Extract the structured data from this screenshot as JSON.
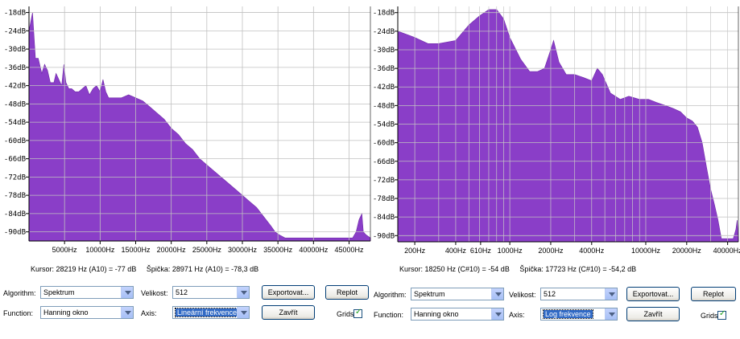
{
  "left": {
    "chart_data": {
      "type": "area",
      "x_scale": "linear",
      "y_unit": "dB",
      "y_ticks": [
        "-18dB",
        "-24dB",
        "-30dB",
        "-36dB",
        "-42dB",
        "-48dB",
        "-54dB",
        "-60dB",
        "-66dB",
        "-72dB",
        "-78dB",
        "-84dB",
        "-90dB"
      ],
      "y_tick_values": [
        -18,
        -24,
        -30,
        -36,
        -42,
        -48,
        -54,
        -60,
        -66,
        -72,
        -78,
        -84,
        -90
      ],
      "x_ticks": [
        "5000Hz",
        "10000Hz",
        "15000Hz",
        "20000Hz",
        "25000Hz",
        "30000Hz",
        "35000Hz",
        "40000Hz",
        "45000Hz"
      ],
      "x_tick_values": [
        5000,
        10000,
        15000,
        20000,
        25000,
        30000,
        35000,
        40000,
        45000
      ],
      "xlim": [
        0,
        48000
      ],
      "ylim": [
        -93,
        -16
      ],
      "grid": true,
      "fill_color": "#8a3ec8",
      "series": [
        {
          "x": [
            0,
            500,
            900,
            1300,
            1800,
            2200,
            2600,
            3000,
            3500,
            3800,
            4200,
            4600,
            4900,
            5200,
            5600,
            6000,
            6500,
            7000,
            7500,
            8000,
            8500,
            9000,
            9500,
            10000,
            10400,
            10800,
            11200,
            12000,
            13000,
            14000,
            15000,
            16000,
            17000,
            18000,
            19000,
            20000,
            21000,
            22000,
            23000,
            24000,
            25000,
            26000,
            27000,
            28000,
            29000,
            30000,
            31000,
            32000,
            33000,
            34000,
            34600,
            35200,
            36000,
            37000,
            45500,
            46000,
            46400,
            46800,
            47000,
            47400,
            48000
          ],
          "y": [
            -24,
            -18,
            -33,
            -33,
            -38,
            -35,
            -37,
            -41,
            -41,
            -38,
            -40,
            -42,
            -35,
            -41,
            -43,
            -43,
            -44,
            -44,
            -43,
            -42,
            -45,
            -43,
            -42,
            -44,
            -40,
            -44,
            -46,
            -46,
            -46,
            -45,
            -46,
            -47,
            -49,
            -51,
            -53,
            -56,
            -58,
            -61,
            -63,
            -66,
            -68,
            -70,
            -72,
            -74,
            -76,
            -78,
            -80,
            -82,
            -85,
            -88,
            -90,
            -91,
            -92,
            -92,
            -92,
            -90,
            -86,
            -84,
            -90,
            -91,
            -92
          ]
        }
      ]
    },
    "status": {
      "cursor": "Kursor: 28219 Hz (A10) = -77 dB",
      "peak": "Špička: 28971 Hz (A10) = -78,3 dB"
    },
    "controls": {
      "algorithm_label": "Algorithm:",
      "algorithm_value": "Spektrum",
      "function_label": "Function:",
      "function_value": "Hanning okno",
      "size_label": "Velikost:",
      "size_value": "512",
      "axis_label": "Axis:",
      "axis_value": "Lineární frekvence",
      "export_label": "Exportovat...",
      "replot_label": "Replot",
      "close_label": "Zavřít",
      "grids_label": "Grids"
    }
  },
  "right": {
    "chart_data": {
      "type": "area",
      "x_scale": "log",
      "y_unit": "dB",
      "y_ticks": [
        "-18dB",
        "-24dB",
        "-30dB",
        "-36dB",
        "-42dB",
        "-48dB",
        "-54dB",
        "-60dB",
        "-66dB",
        "-72dB",
        "-78dB",
        "-84dB",
        "-90dB"
      ],
      "y_tick_values": [
        -18,
        -24,
        -30,
        -36,
        -42,
        -48,
        -54,
        -60,
        -66,
        -72,
        -78,
        -84,
        -90
      ],
      "x_ticks": [
        "200Hz",
        "400Hz",
        "610Hz",
        "1000Hz",
        "2000Hz",
        "4000Hz",
        "10000Hz",
        "20000Hz",
        "40000Hz"
      ],
      "x_tick_values": [
        200,
        400,
        610,
        1000,
        2000,
        4000,
        10000,
        20000,
        40000
      ],
      "xlim": [
        150,
        48000
      ],
      "ylim": [
        -92,
        -16
      ],
      "grid": true,
      "fill_color": "#8a3ec8",
      "series": [
        {
          "x": [
            150,
            200,
            250,
            300,
            400,
            500,
            600,
            700,
            800,
            900,
            1000,
            1200,
            1400,
            1600,
            1800,
            2000,
            2100,
            2300,
            2600,
            3000,
            3500,
            4000,
            4400,
            4800,
            5500,
            6500,
            7500,
            9000,
            10500,
            12000,
            14000,
            16000,
            18000,
            20000,
            22000,
            24000,
            26000,
            28000,
            30000,
            32000,
            34000,
            36000,
            44000,
            46000,
            47000,
            48000
          ],
          "y": [
            -24,
            -26,
            -28,
            -28,
            -27,
            -22,
            -19,
            -17,
            -17,
            -20,
            -26,
            -33,
            -37,
            -37,
            -36,
            -30,
            -27,
            -34,
            -38,
            -38,
            -39,
            -40,
            -36,
            -38,
            -44,
            -46,
            -45,
            -46,
            -46,
            -47,
            -48,
            -49,
            -50,
            -52,
            -53,
            -55,
            -60,
            -68,
            -75,
            -80,
            -85,
            -91,
            -91,
            -88,
            -85,
            -91
          ]
        }
      ]
    },
    "status": {
      "cursor": "Kursor: 18250 Hz (C#10) = -54 dB",
      "peak": "Špička: 17723 Hz (C#10) = -54,2 dB"
    },
    "controls": {
      "algorithm_label": "Algorithm:",
      "algorithm_value": "Spektrum",
      "function_label": "Function:",
      "function_value": "Hanning okno",
      "size_label": "Velikost:",
      "size_value": "512",
      "axis_label": "Axis:",
      "axis_value": "Log frekvence",
      "export_label": "Exportovat...",
      "replot_label": "Replot",
      "close_label": "Zavřít",
      "grids_label": "Grids"
    }
  }
}
